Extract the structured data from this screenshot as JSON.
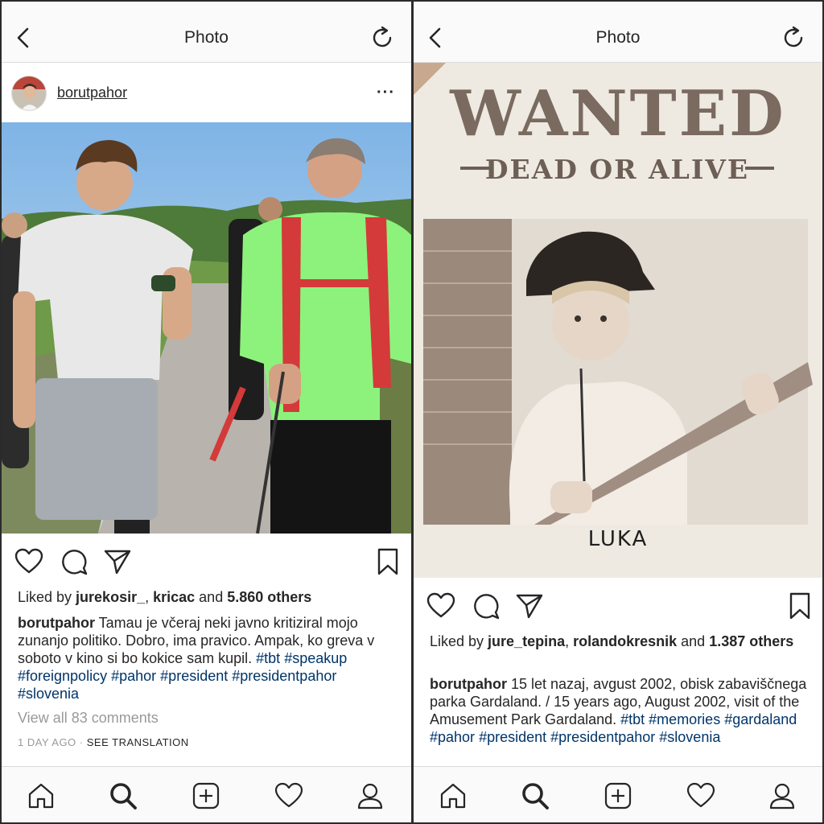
{
  "left": {
    "nav": {
      "title": "Photo"
    },
    "post": {
      "username": "borutpahor",
      "likes": {
        "prefix": "Liked by ",
        "user1": "jurekosir_",
        "sep": ", ",
        "user2": "kricac",
        "and": " and ",
        "others": "5.860 others"
      },
      "caption": {
        "user": "borutpahor",
        "text": " Tamau je včeraj neki javno kritiziral mojo zunanjo politiko. Dobro, ima pravico. Ampak, ko greva v soboto v kino si bo kokice sam kupil. ",
        "tags": [
          "#tbt",
          "#speakup",
          "#foreignpolicy",
          "#pahor",
          "#president",
          "#presidentpahor",
          "#slovenia"
        ]
      },
      "comments": "View all 83 comments",
      "time": "1 DAY AGO",
      "dot": " · ",
      "translate": "SEE TRANSLATION"
    }
  },
  "right": {
    "nav": {
      "title": "Photo"
    },
    "poster": {
      "wanted": "WANTED",
      "subtitle": "DEAD OR ALIVE",
      "name": "LUKA"
    },
    "post": {
      "likes": {
        "prefix": "Liked by ",
        "user1": "jure_tepina",
        "sep": ", ",
        "user2": "rolandokresnik",
        "and": " and ",
        "others": "1.387 others"
      },
      "caption": {
        "user": "borutpahor",
        "text": " 15 let nazaj, avgust 2002, obisk zabaviščnega parka Gardaland. / 15 years ago, August 2002, visit of the Amusement Park Gardaland. ",
        "tags": [
          "#tbt",
          "#memories",
          "#gardaland",
          "#pahor",
          "#president",
          "#presidentpahor",
          "#slovenia"
        ]
      }
    }
  },
  "icons": {
    "nav": [
      "back-arrow-icon",
      "refresh-icon"
    ],
    "actions": [
      "heart-icon",
      "comment-icon",
      "share-icon",
      "bookmark-icon"
    ],
    "tabs": [
      "home-icon",
      "search-icon",
      "add-post-icon",
      "activity-heart-icon",
      "profile-icon"
    ]
  },
  "colors": {
    "hashtag": "#003569",
    "muted": "#999999",
    "text": "#262626",
    "bar_bg": "#fafafa",
    "border": "#dbdbdb"
  }
}
